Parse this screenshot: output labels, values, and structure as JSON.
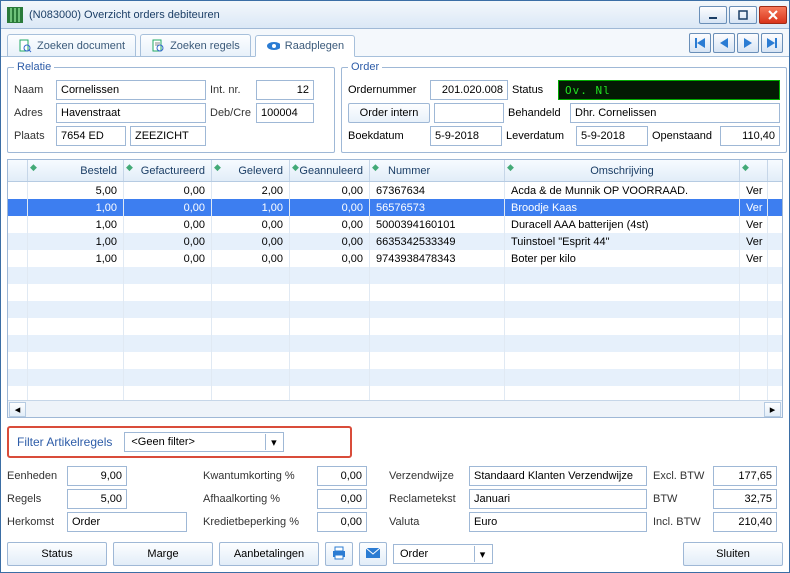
{
  "window": {
    "title": "(N083000) Overzicht orders debiteuren"
  },
  "tabs": {
    "t0": "Zoeken document",
    "t1": "Zoeken regels",
    "t2": "Raadplegen"
  },
  "relatie": {
    "legend": "Relatie",
    "naam_lbl": "Naam",
    "naam": "Cornelissen",
    "intnr_lbl": "Int. nr.",
    "intnr": "12",
    "adres_lbl": "Adres",
    "adres": "Havenstraat",
    "debcre_lbl": "Deb/Cre",
    "debcre": "100004",
    "plaats_lbl": "Plaats",
    "postcode": "7654 ED",
    "plaats": "ZEEZICHT"
  },
  "order": {
    "legend": "Order",
    "ordernr_lbl": "Ordernummer",
    "ordernr": "201.020.008",
    "status_lbl": "Status",
    "status": "Ov. Nl",
    "intern_btn": "Order intern",
    "behandeld_lbl": "Behandeld",
    "behandeld": "Dhr. Cornelissen",
    "boek_lbl": "Boekdatum",
    "boek": "5-9-2018",
    "lever_lbl": "Leverdatum",
    "lever": "5-9-2018",
    "open_lbl": "Openstaand",
    "open": "110,40"
  },
  "grid": {
    "h1": "Besteld",
    "h2": "Gefactureerd",
    "h3": "Geleverd",
    "h4": "Geannuleerd",
    "h5": "Nummer",
    "h6": "Omschrijving",
    "rows": [
      {
        "b": "5,00",
        "f": "0,00",
        "g": "2,00",
        "a": "0,00",
        "n": "67367634",
        "o": "Acda & de Munnik OP VOORRAAD.",
        "e": "Ver"
      },
      {
        "b": "1,00",
        "f": "0,00",
        "g": "1,00",
        "a": "0,00",
        "n": "56576573",
        "o": "Broodje Kaas",
        "e": "Ver"
      },
      {
        "b": "1,00",
        "f": "0,00",
        "g": "0,00",
        "a": "0,00",
        "n": "5000394160101",
        "o": "Duracell AAA batterijen (4st)",
        "e": "Ver"
      },
      {
        "b": "1,00",
        "f": "0,00",
        "g": "0,00",
        "a": "0,00",
        "n": "6635342533349",
        "o": "Tuinstoel \"Esprit 44\"",
        "e": "Ver"
      },
      {
        "b": "1,00",
        "f": "0,00",
        "g": "0,00",
        "a": "0,00",
        "n": "9743938478343",
        "o": "Boter per kilo",
        "e": "Ver"
      }
    ]
  },
  "filter": {
    "label": "Filter Artikelregels",
    "value": "<Geen filter>"
  },
  "bottom": {
    "eenheden_lbl": "Eenheden",
    "eenheden": "9,00",
    "regels_lbl": "Regels",
    "regels": "5,00",
    "herkomst_lbl": "Herkomst",
    "herkomst": "Order",
    "kwant_lbl": "Kwantumkorting %",
    "kwant": "0,00",
    "afhaal_lbl": "Afhaalkorting %",
    "afhaal": "0,00",
    "kred_lbl": "Kredietbeperking %",
    "kred": "0,00",
    "verz_lbl": "Verzendwijze",
    "verz": "Standaard Klanten Verzendwijze",
    "recl_lbl": "Reclametekst",
    "recl": "Januari",
    "valuta_lbl": "Valuta",
    "valuta": "Euro",
    "excl_lbl": "Excl. BTW",
    "excl": "177,65",
    "btw_lbl": "BTW",
    "btw": "32,75",
    "incl_lbl": "Incl. BTW",
    "incl": "210,40"
  },
  "buttons": {
    "status": "Status",
    "marge": "Marge",
    "aanbet": "Aanbetalingen",
    "ordersel": "Order",
    "sluiten": "Sluiten"
  }
}
